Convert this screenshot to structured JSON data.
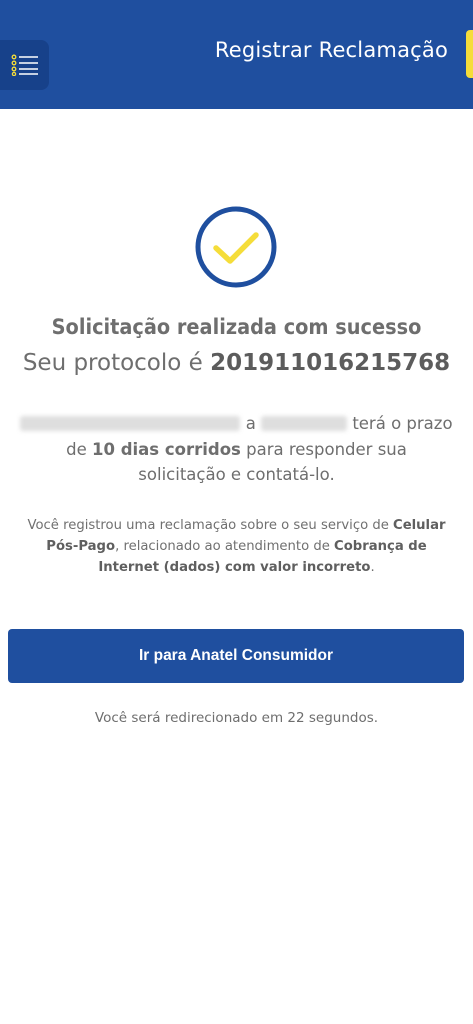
{
  "header": {
    "title": "Registrar Reclamação",
    "menu_icon": "list-menu-icon",
    "color": "#1f4f9f",
    "accent": "#f5dd3a"
  },
  "success": {
    "icon": "check-circle-icon",
    "title": "Solicitação realizada com sucesso",
    "protocol_label": "Seu protocolo é",
    "protocol_number": "201911016215768"
  },
  "prazo": {
    "connector": "a",
    "text_1": "terá o prazo de",
    "days": "10 dias corridos",
    "text_2": "para responder sua solicitação e contatá-lo."
  },
  "info": {
    "prefix": "Você registrou uma reclamação sobre o seu serviço de",
    "service": "Celular Pós-Pago",
    "middle": ", relacionado ao atendimento de",
    "issue": "Cobrança de Internet (dados) com valor incorreto",
    "suffix": "."
  },
  "cta": {
    "label": "Ir para Anatel Consumidor"
  },
  "redirect": {
    "prefix": "Você será redirecionado em",
    "seconds": "22",
    "suffix": "segundos."
  }
}
